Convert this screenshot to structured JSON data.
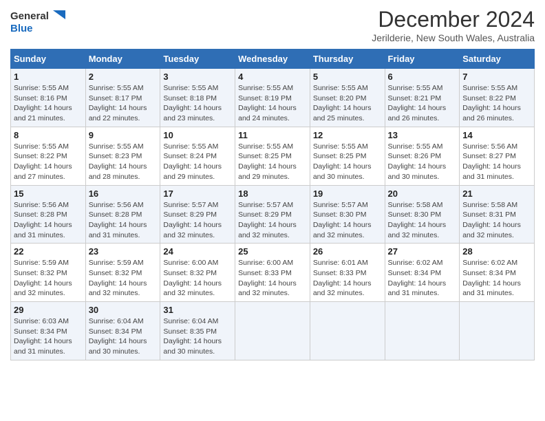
{
  "header": {
    "logo_general": "General",
    "logo_blue": "Blue",
    "title": "December 2024",
    "location": "Jerilderie, New South Wales, Australia"
  },
  "days_of_week": [
    "Sunday",
    "Monday",
    "Tuesday",
    "Wednesday",
    "Thursday",
    "Friday",
    "Saturday"
  ],
  "weeks": [
    [
      {
        "day": "1",
        "sunrise": "5:55 AM",
        "sunset": "8:16 PM",
        "daylight": "14 hours and 21 minutes."
      },
      {
        "day": "2",
        "sunrise": "5:55 AM",
        "sunset": "8:17 PM",
        "daylight": "14 hours and 22 minutes."
      },
      {
        "day": "3",
        "sunrise": "5:55 AM",
        "sunset": "8:18 PM",
        "daylight": "14 hours and 23 minutes."
      },
      {
        "day": "4",
        "sunrise": "5:55 AM",
        "sunset": "8:19 PM",
        "daylight": "14 hours and 24 minutes."
      },
      {
        "day": "5",
        "sunrise": "5:55 AM",
        "sunset": "8:20 PM",
        "daylight": "14 hours and 25 minutes."
      },
      {
        "day": "6",
        "sunrise": "5:55 AM",
        "sunset": "8:21 PM",
        "daylight": "14 hours and 26 minutes."
      },
      {
        "day": "7",
        "sunrise": "5:55 AM",
        "sunset": "8:22 PM",
        "daylight": "14 hours and 26 minutes."
      }
    ],
    [
      {
        "day": "8",
        "sunrise": "5:55 AM",
        "sunset": "8:22 PM",
        "daylight": "14 hours and 27 minutes."
      },
      {
        "day": "9",
        "sunrise": "5:55 AM",
        "sunset": "8:23 PM",
        "daylight": "14 hours and 28 minutes."
      },
      {
        "day": "10",
        "sunrise": "5:55 AM",
        "sunset": "8:24 PM",
        "daylight": "14 hours and 29 minutes."
      },
      {
        "day": "11",
        "sunrise": "5:55 AM",
        "sunset": "8:25 PM",
        "daylight": "14 hours and 29 minutes."
      },
      {
        "day": "12",
        "sunrise": "5:55 AM",
        "sunset": "8:25 PM",
        "daylight": "14 hours and 30 minutes."
      },
      {
        "day": "13",
        "sunrise": "5:55 AM",
        "sunset": "8:26 PM",
        "daylight": "14 hours and 30 minutes."
      },
      {
        "day": "14",
        "sunrise": "5:56 AM",
        "sunset": "8:27 PM",
        "daylight": "14 hours and 31 minutes."
      }
    ],
    [
      {
        "day": "15",
        "sunrise": "5:56 AM",
        "sunset": "8:28 PM",
        "daylight": "14 hours and 31 minutes."
      },
      {
        "day": "16",
        "sunrise": "5:56 AM",
        "sunset": "8:28 PM",
        "daylight": "14 hours and 31 minutes."
      },
      {
        "day": "17",
        "sunrise": "5:57 AM",
        "sunset": "8:29 PM",
        "daylight": "14 hours and 32 minutes."
      },
      {
        "day": "18",
        "sunrise": "5:57 AM",
        "sunset": "8:29 PM",
        "daylight": "14 hours and 32 minutes."
      },
      {
        "day": "19",
        "sunrise": "5:57 AM",
        "sunset": "8:30 PM",
        "daylight": "14 hours and 32 minutes."
      },
      {
        "day": "20",
        "sunrise": "5:58 AM",
        "sunset": "8:30 PM",
        "daylight": "14 hours and 32 minutes."
      },
      {
        "day": "21",
        "sunrise": "5:58 AM",
        "sunset": "8:31 PM",
        "daylight": "14 hours and 32 minutes."
      }
    ],
    [
      {
        "day": "22",
        "sunrise": "5:59 AM",
        "sunset": "8:32 PM",
        "daylight": "14 hours and 32 minutes."
      },
      {
        "day": "23",
        "sunrise": "5:59 AM",
        "sunset": "8:32 PM",
        "daylight": "14 hours and 32 minutes."
      },
      {
        "day": "24",
        "sunrise": "6:00 AM",
        "sunset": "8:32 PM",
        "daylight": "14 hours and 32 minutes."
      },
      {
        "day": "25",
        "sunrise": "6:00 AM",
        "sunset": "8:33 PM",
        "daylight": "14 hours and 32 minutes."
      },
      {
        "day": "26",
        "sunrise": "6:01 AM",
        "sunset": "8:33 PM",
        "daylight": "14 hours and 32 minutes."
      },
      {
        "day": "27",
        "sunrise": "6:02 AM",
        "sunset": "8:34 PM",
        "daylight": "14 hours and 31 minutes."
      },
      {
        "day": "28",
        "sunrise": "6:02 AM",
        "sunset": "8:34 PM",
        "daylight": "14 hours and 31 minutes."
      }
    ],
    [
      {
        "day": "29",
        "sunrise": "6:03 AM",
        "sunset": "8:34 PM",
        "daylight": "14 hours and 31 minutes."
      },
      {
        "day": "30",
        "sunrise": "6:04 AM",
        "sunset": "8:34 PM",
        "daylight": "14 hours and 30 minutes."
      },
      {
        "day": "31",
        "sunrise": "6:04 AM",
        "sunset": "8:35 PM",
        "daylight": "14 hours and 30 minutes."
      },
      null,
      null,
      null,
      null
    ]
  ]
}
